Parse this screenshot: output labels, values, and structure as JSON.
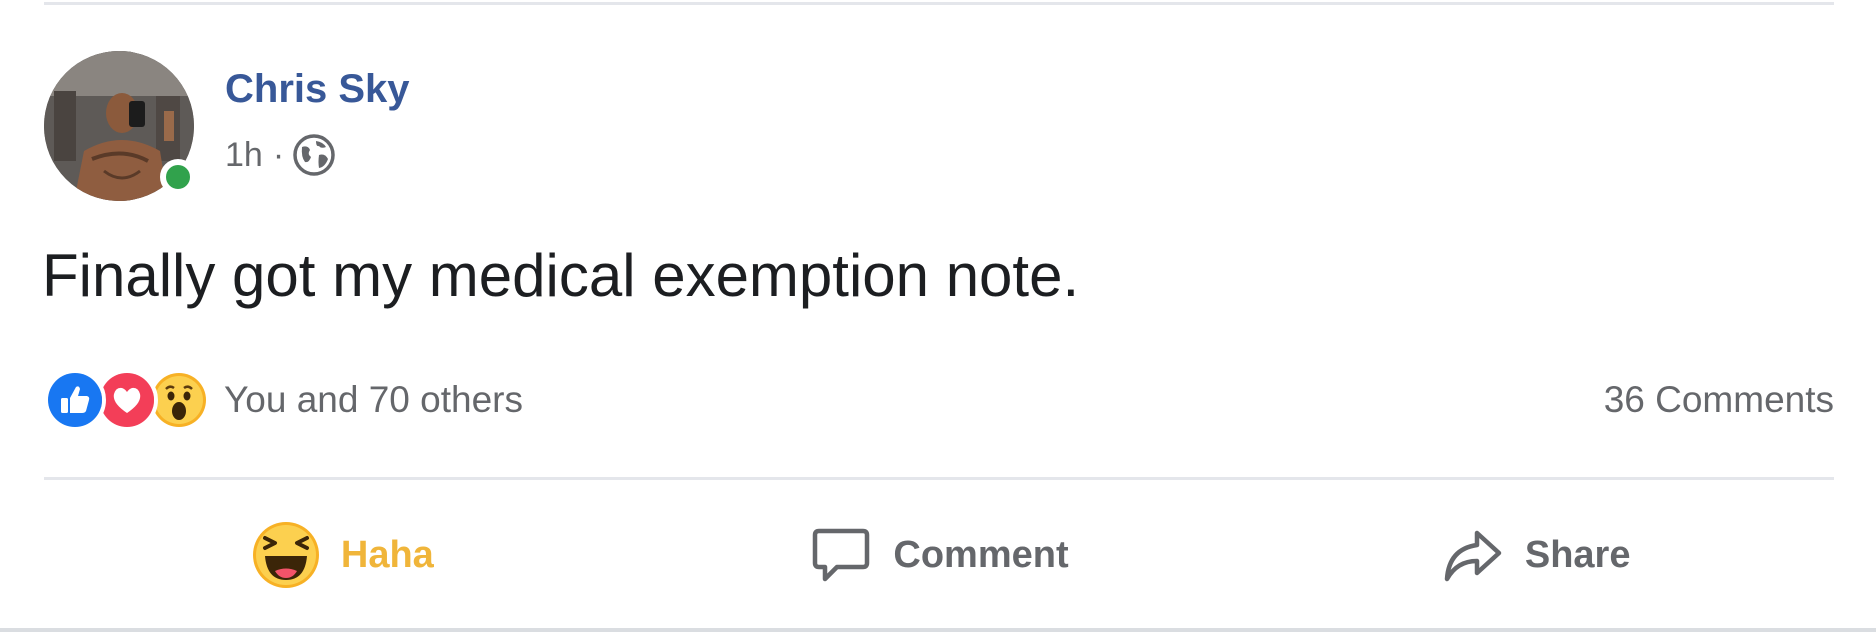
{
  "post": {
    "author": "Chris Sky",
    "time": "1h",
    "separator": "·",
    "audience_icon": "globe-icon",
    "online": true,
    "text": "Finally got my medical exemption note."
  },
  "reactions": {
    "icons": [
      "like-reaction-icon",
      "love-reaction-icon",
      "wow-reaction-icon"
    ],
    "summary": "You and 70 others",
    "comments": "36 Comments"
  },
  "actions": {
    "haha_label": "Haha",
    "comment_label": "Comment",
    "share_label": "Share"
  },
  "colors": {
    "author": "#385898",
    "online": "#31a24c",
    "like": "#1877f2",
    "love": "#f33e58",
    "haha_label": "#f0b53a",
    "secondary_text": "#65676b"
  }
}
